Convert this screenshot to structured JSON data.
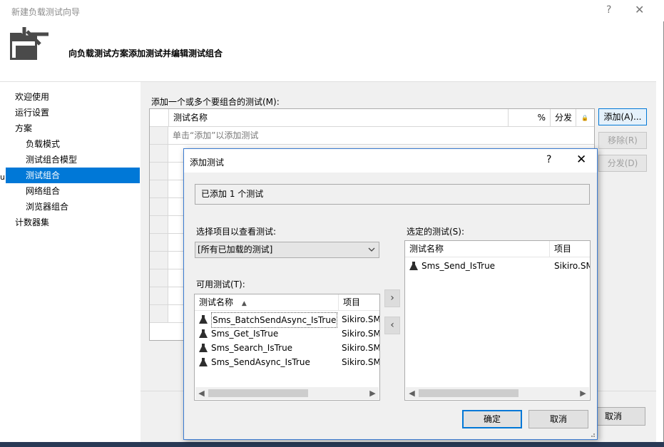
{
  "wizard": {
    "title": "新建负载测试向导",
    "help": "?",
    "close": "✕",
    "heading": "向负载测试方案添加测试并编辑测试组合",
    "cut_char": "u",
    "nav": [
      {
        "label": "欢迎使用",
        "sub": false,
        "selected": false
      },
      {
        "label": "运行设置",
        "sub": false,
        "selected": false
      },
      {
        "label": "方案",
        "sub": false,
        "selected": false
      },
      {
        "label": "负载模式",
        "sub": true,
        "selected": false
      },
      {
        "label": "测试组合模型",
        "sub": true,
        "selected": false
      },
      {
        "label": "测试组合",
        "sub": true,
        "selected": true
      },
      {
        "label": "网络组合",
        "sub": true,
        "selected": false
      },
      {
        "label": "浏览器组合",
        "sub": true,
        "selected": false
      },
      {
        "label": "计数器集",
        "sub": false,
        "selected": false
      }
    ],
    "mix_label": "添加一个或多个要组合的测试(M):",
    "grid": {
      "col_name": "测试名称",
      "col_percent": "%",
      "col_distribute": "分发",
      "col_lock": "🔒",
      "hint": "单击“添加”以添加测试"
    },
    "buttons": {
      "add": "添加(A)...",
      "remove": "移除(R)",
      "distribute": "分发(D)",
      "cancel": "取消"
    }
  },
  "dialog": {
    "title": "添加测试",
    "help": "?",
    "close": "✕",
    "status": "已添加 1 个测试",
    "select_project_label": "选择项目以查看测试:",
    "project_value": "[所有已加载的测试]",
    "available_label": "可用测试(T):",
    "selected_label": "选定的测试(S):",
    "available": {
      "col_name": "测试名称",
      "sort_icon": "▲",
      "col_project": "项目",
      "items": [
        {
          "name": "Sms_BatchSendAsync_IsTrue",
          "project": "Sikiro.SM"
        },
        {
          "name": "Sms_Get_IsTrue",
          "project": "Sikiro.SM"
        },
        {
          "name": "Sms_Search_IsTrue",
          "project": "Sikiro.SM"
        },
        {
          "name": "Sms_SendAsync_IsTrue",
          "project": "Sikiro.SM"
        }
      ]
    },
    "selected": {
      "col_name": "测试名称",
      "col_project": "项目",
      "items": [
        {
          "name": "Sms_Send_IsTrue",
          "project": "Sikiro.SM"
        }
      ]
    },
    "move_right": "›",
    "move_left": "‹",
    "ok": "确定",
    "cancel": "取消"
  },
  "colors": {
    "accent": "#0078d7",
    "panel": "#f0f0f0",
    "taskbar": "#293955"
  }
}
